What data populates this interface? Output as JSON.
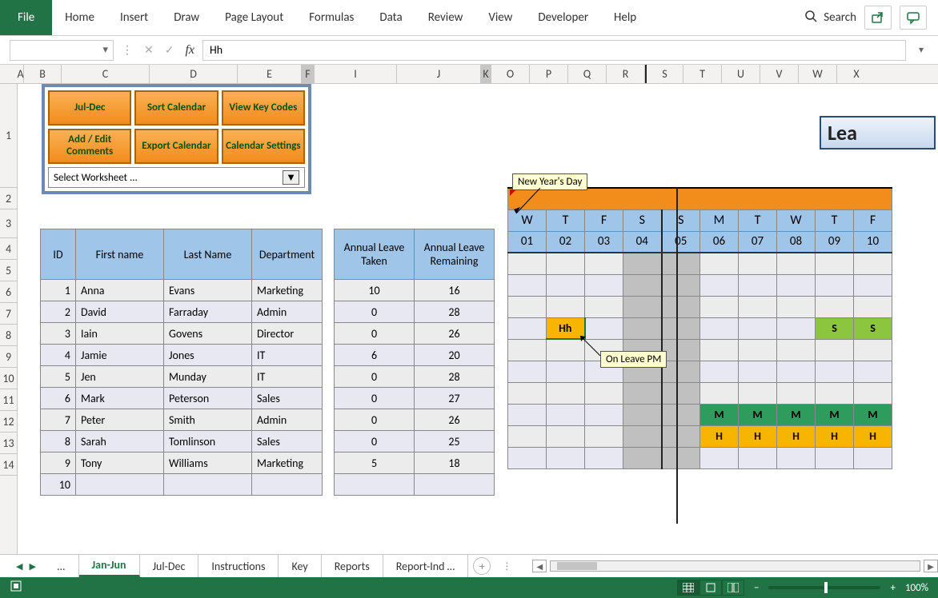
{
  "ribbon": {
    "file": "File",
    "tabs": [
      "Home",
      "Insert",
      "Draw",
      "Page Layout",
      "Formulas",
      "Data",
      "Review",
      "View",
      "Developer",
      "Help"
    ],
    "search": "Search"
  },
  "formula_bar": {
    "namebox": "",
    "value": "Hh"
  },
  "columns": [
    "A",
    "B",
    "C",
    "D",
    "E",
    "F",
    "I",
    "J",
    "K",
    "O",
    "P",
    "Q",
    "R",
    "S",
    "T",
    "U",
    "V",
    "W",
    "X"
  ],
  "rows": [
    "1",
    "2",
    "3",
    "4",
    "5",
    "6",
    "7",
    "8",
    "9",
    "10",
    "11",
    "12",
    "13",
    "14"
  ],
  "panel_buttons": [
    [
      "Jul-Dec",
      "Sort Calendar",
      "View Key Codes"
    ],
    [
      "Add / Edit Comments",
      "Export Calendar",
      "Calendar Settings"
    ]
  ],
  "panel_dropdown": "Select Worksheet ...",
  "table": {
    "headers": [
      "ID",
      "First name",
      "Last Name",
      "Department"
    ],
    "leave_headers": [
      "Annual Leave Taken",
      "Annual Leave Remaining"
    ],
    "rows": [
      {
        "id": "1",
        "fn": "Anna",
        "ln": "Evans",
        "dept": "Marketing",
        "taken": "10",
        "rem": "16"
      },
      {
        "id": "2",
        "fn": "David",
        "ln": "Farraday",
        "dept": "Admin",
        "taken": "0",
        "rem": "28"
      },
      {
        "id": "3",
        "fn": "Iain",
        "ln": "Govens",
        "dept": "Director",
        "taken": "0",
        "rem": "26"
      },
      {
        "id": "4",
        "fn": "Jamie",
        "ln": "Jones",
        "dept": "IT",
        "taken": "6",
        "rem": "20"
      },
      {
        "id": "5",
        "fn": "Jen",
        "ln": "Munday",
        "dept": "IT",
        "taken": "0",
        "rem": "28"
      },
      {
        "id": "6",
        "fn": "Mark",
        "ln": "Peterson",
        "dept": "Sales",
        "taken": "0",
        "rem": "27"
      },
      {
        "id": "7",
        "fn": "Peter",
        "ln": "Smith",
        "dept": "Admin",
        "taken": "0",
        "rem": "26"
      },
      {
        "id": "8",
        "fn": "Sarah",
        "ln": "Tomlinson",
        "dept": "Sales",
        "taken": "0",
        "rem": "25"
      },
      {
        "id": "9",
        "fn": "Tony",
        "ln": "Williams",
        "dept": "Marketing",
        "taken": "5",
        "rem": "18"
      },
      {
        "id": "10",
        "fn": "",
        "ln": "",
        "dept": "",
        "taken": "",
        "rem": ""
      }
    ]
  },
  "calendar": {
    "banner": "Lea",
    "days_labels": [
      "W",
      "T",
      "F",
      "S",
      "S",
      "M",
      "T",
      "W",
      "T",
      "F"
    ],
    "days_nums": [
      "01",
      "02",
      "03",
      "04",
      "05",
      "06",
      "07",
      "08",
      "09",
      "10"
    ],
    "weekend_cols": [
      3,
      4
    ],
    "cells": {
      "3": {
        "1": "Hh"
      },
      "7": {
        "5": "M",
        "6": "M",
        "7": "M",
        "8": "M",
        "9": "M"
      },
      "8": {
        "5": "H",
        "6": "H",
        "7": "H",
        "8": "H",
        "9": "H"
      },
      "3b": {
        "8": "S",
        "9": "S"
      }
    },
    "s_codes_row": 3,
    "s_codes_cols": [
      8,
      9
    ],
    "hh_row": 3,
    "hh_col": 1,
    "notes": {
      "newyear": "New Year's Day",
      "onleave": "On Leave PM"
    }
  },
  "sheets": {
    "overflow": "...",
    "tabs": [
      "Jan-Jun",
      "Jul-Dec",
      "Instructions",
      "Key",
      "Reports",
      "Report-Ind …"
    ],
    "active": 0
  },
  "status": {
    "zoom": "100%"
  }
}
